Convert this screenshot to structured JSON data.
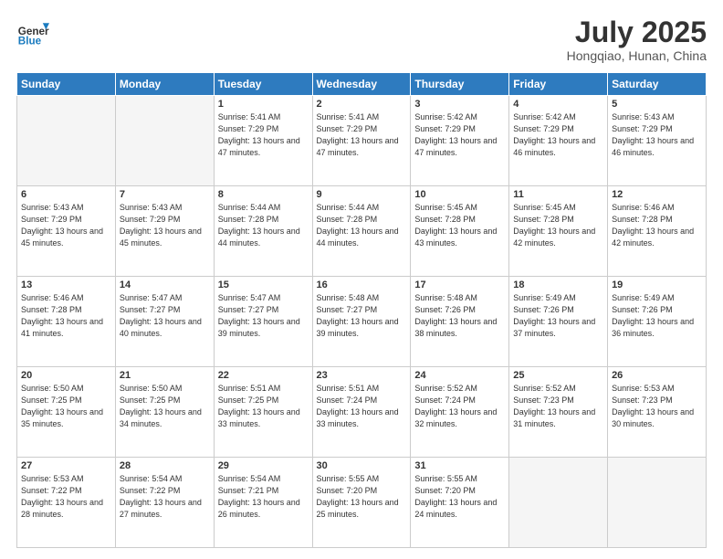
{
  "header": {
    "logo_line1": "General",
    "logo_line2": "Blue",
    "month_year": "July 2025",
    "location": "Hongqiao, Hunan, China"
  },
  "weekdays": [
    "Sunday",
    "Monday",
    "Tuesday",
    "Wednesday",
    "Thursday",
    "Friday",
    "Saturday"
  ],
  "weeks": [
    [
      {
        "day": "",
        "info": ""
      },
      {
        "day": "",
        "info": ""
      },
      {
        "day": "1",
        "info": "Sunrise: 5:41 AM\nSunset: 7:29 PM\nDaylight: 13 hours and 47 minutes."
      },
      {
        "day": "2",
        "info": "Sunrise: 5:41 AM\nSunset: 7:29 PM\nDaylight: 13 hours and 47 minutes."
      },
      {
        "day": "3",
        "info": "Sunrise: 5:42 AM\nSunset: 7:29 PM\nDaylight: 13 hours and 47 minutes."
      },
      {
        "day": "4",
        "info": "Sunrise: 5:42 AM\nSunset: 7:29 PM\nDaylight: 13 hours and 46 minutes."
      },
      {
        "day": "5",
        "info": "Sunrise: 5:43 AM\nSunset: 7:29 PM\nDaylight: 13 hours and 46 minutes."
      }
    ],
    [
      {
        "day": "6",
        "info": "Sunrise: 5:43 AM\nSunset: 7:29 PM\nDaylight: 13 hours and 45 minutes."
      },
      {
        "day": "7",
        "info": "Sunrise: 5:43 AM\nSunset: 7:29 PM\nDaylight: 13 hours and 45 minutes."
      },
      {
        "day": "8",
        "info": "Sunrise: 5:44 AM\nSunset: 7:28 PM\nDaylight: 13 hours and 44 minutes."
      },
      {
        "day": "9",
        "info": "Sunrise: 5:44 AM\nSunset: 7:28 PM\nDaylight: 13 hours and 44 minutes."
      },
      {
        "day": "10",
        "info": "Sunrise: 5:45 AM\nSunset: 7:28 PM\nDaylight: 13 hours and 43 minutes."
      },
      {
        "day": "11",
        "info": "Sunrise: 5:45 AM\nSunset: 7:28 PM\nDaylight: 13 hours and 42 minutes."
      },
      {
        "day": "12",
        "info": "Sunrise: 5:46 AM\nSunset: 7:28 PM\nDaylight: 13 hours and 42 minutes."
      }
    ],
    [
      {
        "day": "13",
        "info": "Sunrise: 5:46 AM\nSunset: 7:28 PM\nDaylight: 13 hours and 41 minutes."
      },
      {
        "day": "14",
        "info": "Sunrise: 5:47 AM\nSunset: 7:27 PM\nDaylight: 13 hours and 40 minutes."
      },
      {
        "day": "15",
        "info": "Sunrise: 5:47 AM\nSunset: 7:27 PM\nDaylight: 13 hours and 39 minutes."
      },
      {
        "day": "16",
        "info": "Sunrise: 5:48 AM\nSunset: 7:27 PM\nDaylight: 13 hours and 39 minutes."
      },
      {
        "day": "17",
        "info": "Sunrise: 5:48 AM\nSunset: 7:26 PM\nDaylight: 13 hours and 38 minutes."
      },
      {
        "day": "18",
        "info": "Sunrise: 5:49 AM\nSunset: 7:26 PM\nDaylight: 13 hours and 37 minutes."
      },
      {
        "day": "19",
        "info": "Sunrise: 5:49 AM\nSunset: 7:26 PM\nDaylight: 13 hours and 36 minutes."
      }
    ],
    [
      {
        "day": "20",
        "info": "Sunrise: 5:50 AM\nSunset: 7:25 PM\nDaylight: 13 hours and 35 minutes."
      },
      {
        "day": "21",
        "info": "Sunrise: 5:50 AM\nSunset: 7:25 PM\nDaylight: 13 hours and 34 minutes."
      },
      {
        "day": "22",
        "info": "Sunrise: 5:51 AM\nSunset: 7:25 PM\nDaylight: 13 hours and 33 minutes."
      },
      {
        "day": "23",
        "info": "Sunrise: 5:51 AM\nSunset: 7:24 PM\nDaylight: 13 hours and 33 minutes."
      },
      {
        "day": "24",
        "info": "Sunrise: 5:52 AM\nSunset: 7:24 PM\nDaylight: 13 hours and 32 minutes."
      },
      {
        "day": "25",
        "info": "Sunrise: 5:52 AM\nSunset: 7:23 PM\nDaylight: 13 hours and 31 minutes."
      },
      {
        "day": "26",
        "info": "Sunrise: 5:53 AM\nSunset: 7:23 PM\nDaylight: 13 hours and 30 minutes."
      }
    ],
    [
      {
        "day": "27",
        "info": "Sunrise: 5:53 AM\nSunset: 7:22 PM\nDaylight: 13 hours and 28 minutes."
      },
      {
        "day": "28",
        "info": "Sunrise: 5:54 AM\nSunset: 7:22 PM\nDaylight: 13 hours and 27 minutes."
      },
      {
        "day": "29",
        "info": "Sunrise: 5:54 AM\nSunset: 7:21 PM\nDaylight: 13 hours and 26 minutes."
      },
      {
        "day": "30",
        "info": "Sunrise: 5:55 AM\nSunset: 7:20 PM\nDaylight: 13 hours and 25 minutes."
      },
      {
        "day": "31",
        "info": "Sunrise: 5:55 AM\nSunset: 7:20 PM\nDaylight: 13 hours and 24 minutes."
      },
      {
        "day": "",
        "info": ""
      },
      {
        "day": "",
        "info": ""
      }
    ]
  ]
}
